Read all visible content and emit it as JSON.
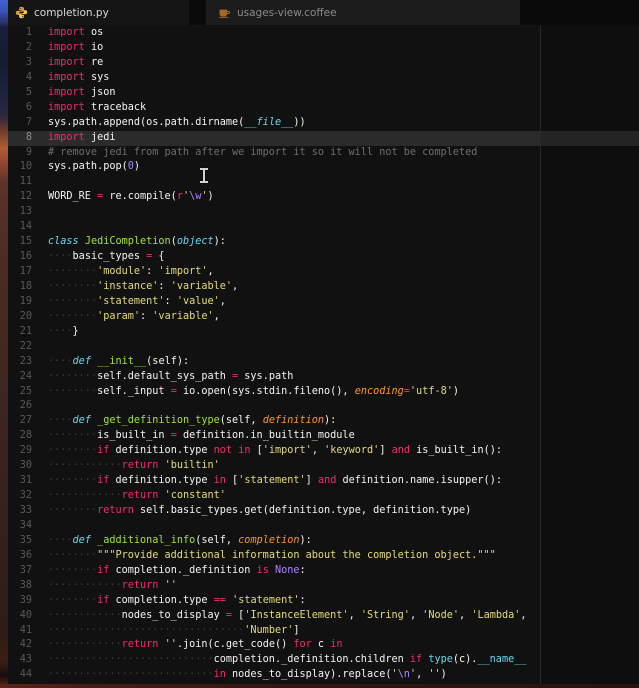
{
  "window": {
    "tabs": [
      {
        "label": "completion.py",
        "icon": "python-icon",
        "active": true
      },
      {
        "label": "usages-view.coffee",
        "icon": "coffee-icon",
        "active": false
      }
    ]
  },
  "colors": {
    "editor_background": "#111112",
    "active_line_background": "#2b2b2c",
    "keyword": "#f92672",
    "string": "#e6db74",
    "constant": "#ae81ff",
    "comment": "#6e6e67",
    "storage": "#66d9ef",
    "function_name": "#a6e22e",
    "parameter": "#fd971f",
    "plain_text": "#f4f4f0"
  },
  "editor": {
    "active_line": 8,
    "ruler_column": 80,
    "lines": [
      {
        "num": 1,
        "tokens": [
          [
            "k",
            "import"
          ],
          [
            "t",
            " os"
          ]
        ]
      },
      {
        "num": 2,
        "tokens": [
          [
            "k",
            "import"
          ],
          [
            "t",
            " io"
          ]
        ]
      },
      {
        "num": 3,
        "tokens": [
          [
            "k",
            "import"
          ],
          [
            "t",
            " re"
          ]
        ]
      },
      {
        "num": 4,
        "tokens": [
          [
            "k",
            "import"
          ],
          [
            "t",
            " sys"
          ]
        ]
      },
      {
        "num": 5,
        "tokens": [
          [
            "k",
            "import"
          ],
          [
            "t",
            " json"
          ]
        ]
      },
      {
        "num": 6,
        "tokens": [
          [
            "k",
            "import"
          ],
          [
            "t",
            " traceback"
          ]
        ]
      },
      {
        "num": 7,
        "tokens": [
          [
            "t",
            "sys.path.append(os.path.dirname("
          ],
          [
            "bi",
            "__file__"
          ],
          [
            "t",
            "))"
          ]
        ]
      },
      {
        "num": 8,
        "tokens": [
          [
            "k",
            "import"
          ],
          [
            "t",
            " jedi"
          ]
        ]
      },
      {
        "num": 9,
        "tokens": [
          [
            "c",
            "# remove jedi from path after we import it so it will not be completed"
          ]
        ]
      },
      {
        "num": 10,
        "tokens": [
          [
            "t",
            "sys.path.pop("
          ],
          [
            "n",
            "0"
          ],
          [
            "t",
            ")"
          ]
        ]
      },
      {
        "num": 11,
        "tokens": []
      },
      {
        "num": 12,
        "tokens": [
          [
            "t",
            "WORD_RE "
          ],
          [
            "k",
            "="
          ],
          [
            "t",
            " re.compile("
          ],
          [
            "k",
            "r"
          ],
          [
            "s",
            "'"
          ],
          [
            "n",
            "\\w"
          ],
          [
            "s",
            "'"
          ],
          [
            "t",
            ")"
          ]
        ]
      },
      {
        "num": 13,
        "tokens": []
      },
      {
        "num": 14,
        "tokens": []
      },
      {
        "num": 15,
        "tokens": [
          [
            "d",
            "class"
          ],
          [
            "t",
            " "
          ],
          [
            "f",
            "JediCompletion"
          ],
          [
            "t",
            "("
          ],
          [
            "bi",
            "object"
          ],
          [
            "t",
            "):"
          ]
        ]
      },
      {
        "num": 16,
        "tokens": [
          [
            "w",
            4
          ],
          [
            "t",
            "basic_types "
          ],
          [
            "k",
            "="
          ],
          [
            "t",
            " {"
          ]
        ]
      },
      {
        "num": 17,
        "tokens": [
          [
            "w",
            8
          ],
          [
            "s",
            "'module'"
          ],
          [
            "t",
            ": "
          ],
          [
            "s",
            "'import'"
          ],
          [
            "t",
            ","
          ]
        ]
      },
      {
        "num": 18,
        "tokens": [
          [
            "w",
            8
          ],
          [
            "s",
            "'instance'"
          ],
          [
            "t",
            ": "
          ],
          [
            "s",
            "'variable'"
          ],
          [
            "t",
            ","
          ]
        ]
      },
      {
        "num": 19,
        "tokens": [
          [
            "w",
            8
          ],
          [
            "s",
            "'statement'"
          ],
          [
            "t",
            ": "
          ],
          [
            "s",
            "'value'"
          ],
          [
            "t",
            ","
          ]
        ]
      },
      {
        "num": 20,
        "tokens": [
          [
            "w",
            8
          ],
          [
            "s",
            "'param'"
          ],
          [
            "t",
            ": "
          ],
          [
            "s",
            "'variable'"
          ],
          [
            "t",
            ","
          ]
        ]
      },
      {
        "num": 21,
        "tokens": [
          [
            "w",
            4
          ],
          [
            "t",
            "}"
          ]
        ]
      },
      {
        "num": 22,
        "tokens": []
      },
      {
        "num": 23,
        "tokens": [
          [
            "w",
            4
          ],
          [
            "d",
            "def"
          ],
          [
            "t",
            " "
          ],
          [
            "f",
            "__init__"
          ],
          [
            "t",
            "(self):"
          ]
        ]
      },
      {
        "num": 24,
        "tokens": [
          [
            "w",
            8
          ],
          [
            "t",
            "self.default_sys_path "
          ],
          [
            "k",
            "="
          ],
          [
            "t",
            " sys.path"
          ]
        ]
      },
      {
        "num": 25,
        "tokens": [
          [
            "w",
            8
          ],
          [
            "t",
            "self._input "
          ],
          [
            "k",
            "="
          ],
          [
            "t",
            " io.open(sys.stdin.fileno(), "
          ],
          [
            "p",
            "encoding"
          ],
          [
            "k",
            "="
          ],
          [
            "s",
            "'utf-8'"
          ],
          [
            "t",
            ")"
          ]
        ]
      },
      {
        "num": 26,
        "tokens": []
      },
      {
        "num": 27,
        "tokens": [
          [
            "w",
            4
          ],
          [
            "d",
            "def"
          ],
          [
            "t",
            " "
          ],
          [
            "f",
            "_get_definition_type"
          ],
          [
            "t",
            "(self, "
          ],
          [
            "p",
            "definition"
          ],
          [
            "t",
            "):"
          ]
        ]
      },
      {
        "num": 28,
        "tokens": [
          [
            "w",
            8
          ],
          [
            "t",
            "is_built_in "
          ],
          [
            "k",
            "="
          ],
          [
            "t",
            " definition.in_builtin_module"
          ]
        ]
      },
      {
        "num": 29,
        "tokens": [
          [
            "w",
            8
          ],
          [
            "k",
            "if"
          ],
          [
            "t",
            " definition.type "
          ],
          [
            "k",
            "not"
          ],
          [
            "t",
            " "
          ],
          [
            "k",
            "in"
          ],
          [
            "t",
            " ["
          ],
          [
            "s",
            "'import'"
          ],
          [
            "t",
            ", "
          ],
          [
            "s",
            "'keyword'"
          ],
          [
            "t",
            "] "
          ],
          [
            "k",
            "and"
          ],
          [
            "t",
            " is_built_in():"
          ]
        ]
      },
      {
        "num": 30,
        "tokens": [
          [
            "w",
            12
          ],
          [
            "k",
            "return"
          ],
          [
            "t",
            " "
          ],
          [
            "s",
            "'builtin'"
          ]
        ]
      },
      {
        "num": 31,
        "tokens": [
          [
            "w",
            8
          ],
          [
            "k",
            "if"
          ],
          [
            "t",
            " definition.type "
          ],
          [
            "k",
            "in"
          ],
          [
            "t",
            " ["
          ],
          [
            "s",
            "'statement'"
          ],
          [
            "t",
            "] "
          ],
          [
            "k",
            "and"
          ],
          [
            "t",
            " definition.name.isupper():"
          ]
        ]
      },
      {
        "num": 32,
        "tokens": [
          [
            "w",
            12
          ],
          [
            "k",
            "return"
          ],
          [
            "t",
            " "
          ],
          [
            "s",
            "'constant'"
          ]
        ]
      },
      {
        "num": 33,
        "tokens": [
          [
            "w",
            8
          ],
          [
            "k",
            "return"
          ],
          [
            "t",
            " self.basic_types.get(definition.type, definition.type)"
          ]
        ]
      },
      {
        "num": 34,
        "tokens": []
      },
      {
        "num": 35,
        "tokens": [
          [
            "w",
            4
          ],
          [
            "d",
            "def"
          ],
          [
            "t",
            " "
          ],
          [
            "f",
            "_additional_info"
          ],
          [
            "t",
            "(self, "
          ],
          [
            "p",
            "completion"
          ],
          [
            "t",
            "):"
          ]
        ]
      },
      {
        "num": 36,
        "tokens": [
          [
            "w",
            8
          ],
          [
            "s",
            "\"\"\"Provide additional information about the completion object.\"\"\""
          ]
        ]
      },
      {
        "num": 37,
        "tokens": [
          [
            "w",
            8
          ],
          [
            "k",
            "if"
          ],
          [
            "t",
            " completion._definition "
          ],
          [
            "k",
            "is"
          ],
          [
            "t",
            " "
          ],
          [
            "n",
            "None"
          ],
          [
            "t",
            ":"
          ]
        ]
      },
      {
        "num": 38,
        "tokens": [
          [
            "w",
            12
          ],
          [
            "k",
            "return"
          ],
          [
            "t",
            " "
          ],
          [
            "s",
            "''"
          ]
        ]
      },
      {
        "num": 39,
        "tokens": [
          [
            "w",
            8
          ],
          [
            "k",
            "if"
          ],
          [
            "t",
            " completion.type "
          ],
          [
            "k",
            "=="
          ],
          [
            "t",
            " "
          ],
          [
            "s",
            "'statement'"
          ],
          [
            "t",
            ":"
          ]
        ]
      },
      {
        "num": 40,
        "tokens": [
          [
            "w",
            12
          ],
          [
            "t",
            "nodes_to_display "
          ],
          [
            "k",
            "="
          ],
          [
            "t",
            " ["
          ],
          [
            "s",
            "'InstanceElement'"
          ],
          [
            "t",
            ", "
          ],
          [
            "s",
            "'String'"
          ],
          [
            "t",
            ", "
          ],
          [
            "s",
            "'Node'"
          ],
          [
            "t",
            ", "
          ],
          [
            "s",
            "'Lambda'"
          ],
          [
            "t",
            ","
          ]
        ]
      },
      {
        "num": 41,
        "tokens": [
          [
            "w",
            32
          ],
          [
            "s",
            "'Number'"
          ],
          [
            "t",
            "]"
          ]
        ]
      },
      {
        "num": 42,
        "tokens": [
          [
            "w",
            12
          ],
          [
            "k",
            "return"
          ],
          [
            "t",
            " "
          ],
          [
            "s",
            "''"
          ],
          [
            "t",
            ".join(c.get_code() "
          ],
          [
            "k",
            "for"
          ],
          [
            "t",
            " c "
          ],
          [
            "k",
            "in"
          ]
        ]
      },
      {
        "num": 43,
        "tokens": [
          [
            "w",
            27
          ],
          [
            "t",
            "completion._definition.children "
          ],
          [
            "k",
            "if"
          ],
          [
            "t",
            " "
          ],
          [
            "b",
            "type"
          ],
          [
            "t",
            "(c)."
          ],
          [
            "b",
            "__name__"
          ]
        ]
      },
      {
        "num": 44,
        "tokens": [
          [
            "w",
            27
          ],
          [
            "k",
            "in"
          ],
          [
            "t",
            " nodes_to_display).replace("
          ],
          [
            "s",
            "'"
          ],
          [
            "n",
            "\\n"
          ],
          [
            "s",
            "'"
          ],
          [
            "t",
            ", "
          ],
          [
            "s",
            "''"
          ],
          [
            "t",
            ")"
          ]
        ]
      }
    ]
  }
}
